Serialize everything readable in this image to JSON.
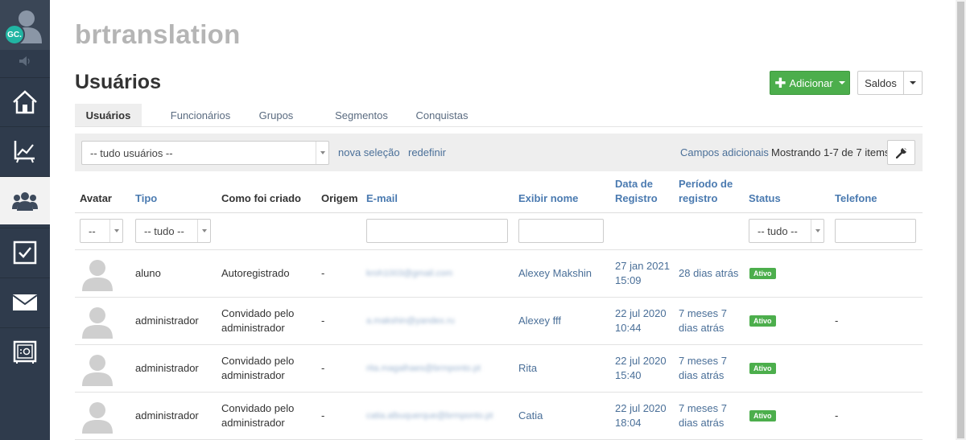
{
  "sidebar": {
    "user_initials": "GC.",
    "items": [
      {
        "name": "home",
        "icon": "home-icon"
      },
      {
        "name": "reports",
        "icon": "chart-icon"
      },
      {
        "name": "users",
        "icon": "users-icon",
        "active": true
      },
      {
        "name": "tasks",
        "icon": "checkbox-icon"
      },
      {
        "name": "messages",
        "icon": "envelope-icon"
      },
      {
        "name": "vault",
        "icon": "safe-icon"
      }
    ]
  },
  "header": {
    "brand": "brtranslation",
    "page_title": "Usuários",
    "add_button": "Adicionar",
    "saldos_button": "Saldos"
  },
  "tabs": [
    {
      "label": "Usuários",
      "active": true
    },
    {
      "label": "Funcionários"
    },
    {
      "label": "Grupos"
    },
    {
      "label": "Segmentos"
    },
    {
      "label": "Conquistas"
    }
  ],
  "filterbar": {
    "selection_value": "-- tudo usuários --",
    "new_selection": "nova seleção",
    "reset": "redefinir",
    "extra_fields": "Campos adicionais",
    "showing": "Mostrando 1-7 de 7 items."
  },
  "table": {
    "headers": {
      "avatar": "Avatar",
      "tipo": "Tipo",
      "como": "Como foi criado",
      "origem": "Origem",
      "email": "E-mail",
      "exibir": "Exibir nome",
      "data_l1": "Data de",
      "data_l2": "Registro",
      "periodo_l1": "Período de",
      "periodo_l2": "registro",
      "status": "Status",
      "telefone": "Telefone"
    },
    "filters": {
      "avatar": "--",
      "tipo": "-- tudo --",
      "status": "-- tudo --"
    },
    "rows": [
      {
        "tipo": "aluno",
        "como_l1": "Autoregistrado",
        "como_l2": "",
        "origem": "-",
        "email": "kroh1003@gmail.com",
        "nome": "Alexey Makshin",
        "data_l1": "27 jan 2021",
        "data_l2": "15:09",
        "periodo_l1": "28 dias atrás",
        "periodo_l2": "",
        "status": "Ativo",
        "telefone": ""
      },
      {
        "tipo": "administrador",
        "como_l1": "Convidado pelo",
        "como_l2": "administrador",
        "origem": "-",
        "email": "a.makshin@yandex.ru",
        "nome": "Alexey fff",
        "data_l1": "22 jul 2020",
        "data_l2": "10:44",
        "periodo_l1": "7 meses 7",
        "periodo_l2": "dias atrás",
        "status": "Ativo",
        "telefone": "-"
      },
      {
        "tipo": "administrador",
        "como_l1": "Convidado pelo",
        "como_l2": "administrador",
        "origem": "-",
        "email": "rita.magalhaes@brmponto.pt",
        "nome": "Rita",
        "data_l1": "22 jul 2020",
        "data_l2": "15:40",
        "periodo_l1": "7 meses 7",
        "periodo_l2": "dias atrás",
        "status": "Ativo",
        "telefone": ""
      },
      {
        "tipo": "administrador",
        "como_l1": "Convidado pelo",
        "como_l2": "administrador",
        "origem": "-",
        "email": "catia.albuquerque@brmponto.pt",
        "nome": "Catia",
        "data_l1": "22 jul 2020",
        "data_l2": "18:04",
        "periodo_l1": "7 meses 7",
        "periodo_l2": "dias atrás",
        "status": "Ativo",
        "telefone": "-"
      }
    ]
  },
  "colors": {
    "sidebar_bg": "#2f3b4c",
    "accent_green": "#4cae4c",
    "link_blue": "#4a6f98",
    "initials_teal": "#21b5a3"
  }
}
